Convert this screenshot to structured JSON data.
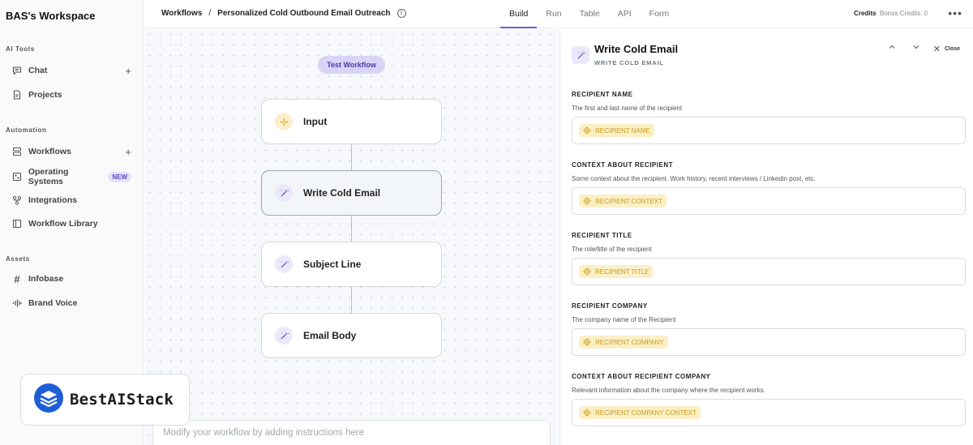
{
  "sidebar": {
    "workspace": "BAS's Workspace",
    "sections": {
      "ai_tools": "AI Tools",
      "automation": "Automation",
      "assets": "Assets"
    },
    "items": {
      "chat": "Chat",
      "projects": "Projects",
      "workflows": "Workflows",
      "operating_systems": "Operating Systems",
      "operating_systems_badge": "NEW",
      "integrations": "Integrations",
      "workflow_library": "Workflow Library",
      "infobase": "Infobase",
      "brand_voice": "Brand Voice"
    }
  },
  "header": {
    "breadcrumb_root": "Workflows",
    "breadcrumb_sep": "/",
    "breadcrumb_current": "Personalized Cold Outbound Email Outreach",
    "tabs": [
      "Build",
      "Run",
      "Table",
      "API",
      "Form"
    ],
    "active_tab": "Build",
    "credits_label": "Credits",
    "bonus_credits": "Bonus Credits: 0"
  },
  "canvas": {
    "test_button": "Test Workflow",
    "nodes": [
      {
        "label": "Input",
        "kind": "input"
      },
      {
        "label": "Write Cold Email",
        "kind": "ai",
        "selected": true
      },
      {
        "label": "Subject Line",
        "kind": "ai"
      },
      {
        "label": "Email Body",
        "kind": "ai"
      }
    ],
    "prompt_placeholder": "Modify your workflow by adding instructions here"
  },
  "logo": {
    "text": "BestAIStack"
  },
  "panel": {
    "title": "Write Cold Email",
    "subtitle": "WRITE COLD EMAIL",
    "close_label": "Close",
    "fields": [
      {
        "label": "RECIPIENT NAME",
        "desc": "The first and last name of the recipient",
        "chip": "RECIPIENT NAME"
      },
      {
        "label": "CONTEXT ABOUT RECIPIENT",
        "desc": "Some context about the recipient. Work history, recent interviews / Linkedin post, etc.",
        "chip": "RECIPIENT CONTEXT"
      },
      {
        "label": "RECIPIENT TITLE",
        "desc": "The role/title of the recipient",
        "chip": "RECIPIENT TITLE"
      },
      {
        "label": "RECIPIENT COMPANY",
        "desc": "The company name of the Recipient",
        "chip": "RECIPIENT COMPANY"
      },
      {
        "label": "CONTEXT ABOUT RECIPIENT COMPANY",
        "desc": "Relevant information about the company where the recipient works.",
        "chip": "RECIPIENT COMPANY CONTEXT"
      }
    ]
  },
  "colors": {
    "accent": "#6c5cd6",
    "chip_bg": "#fbefc6",
    "chip_text": "#c99a1a"
  }
}
